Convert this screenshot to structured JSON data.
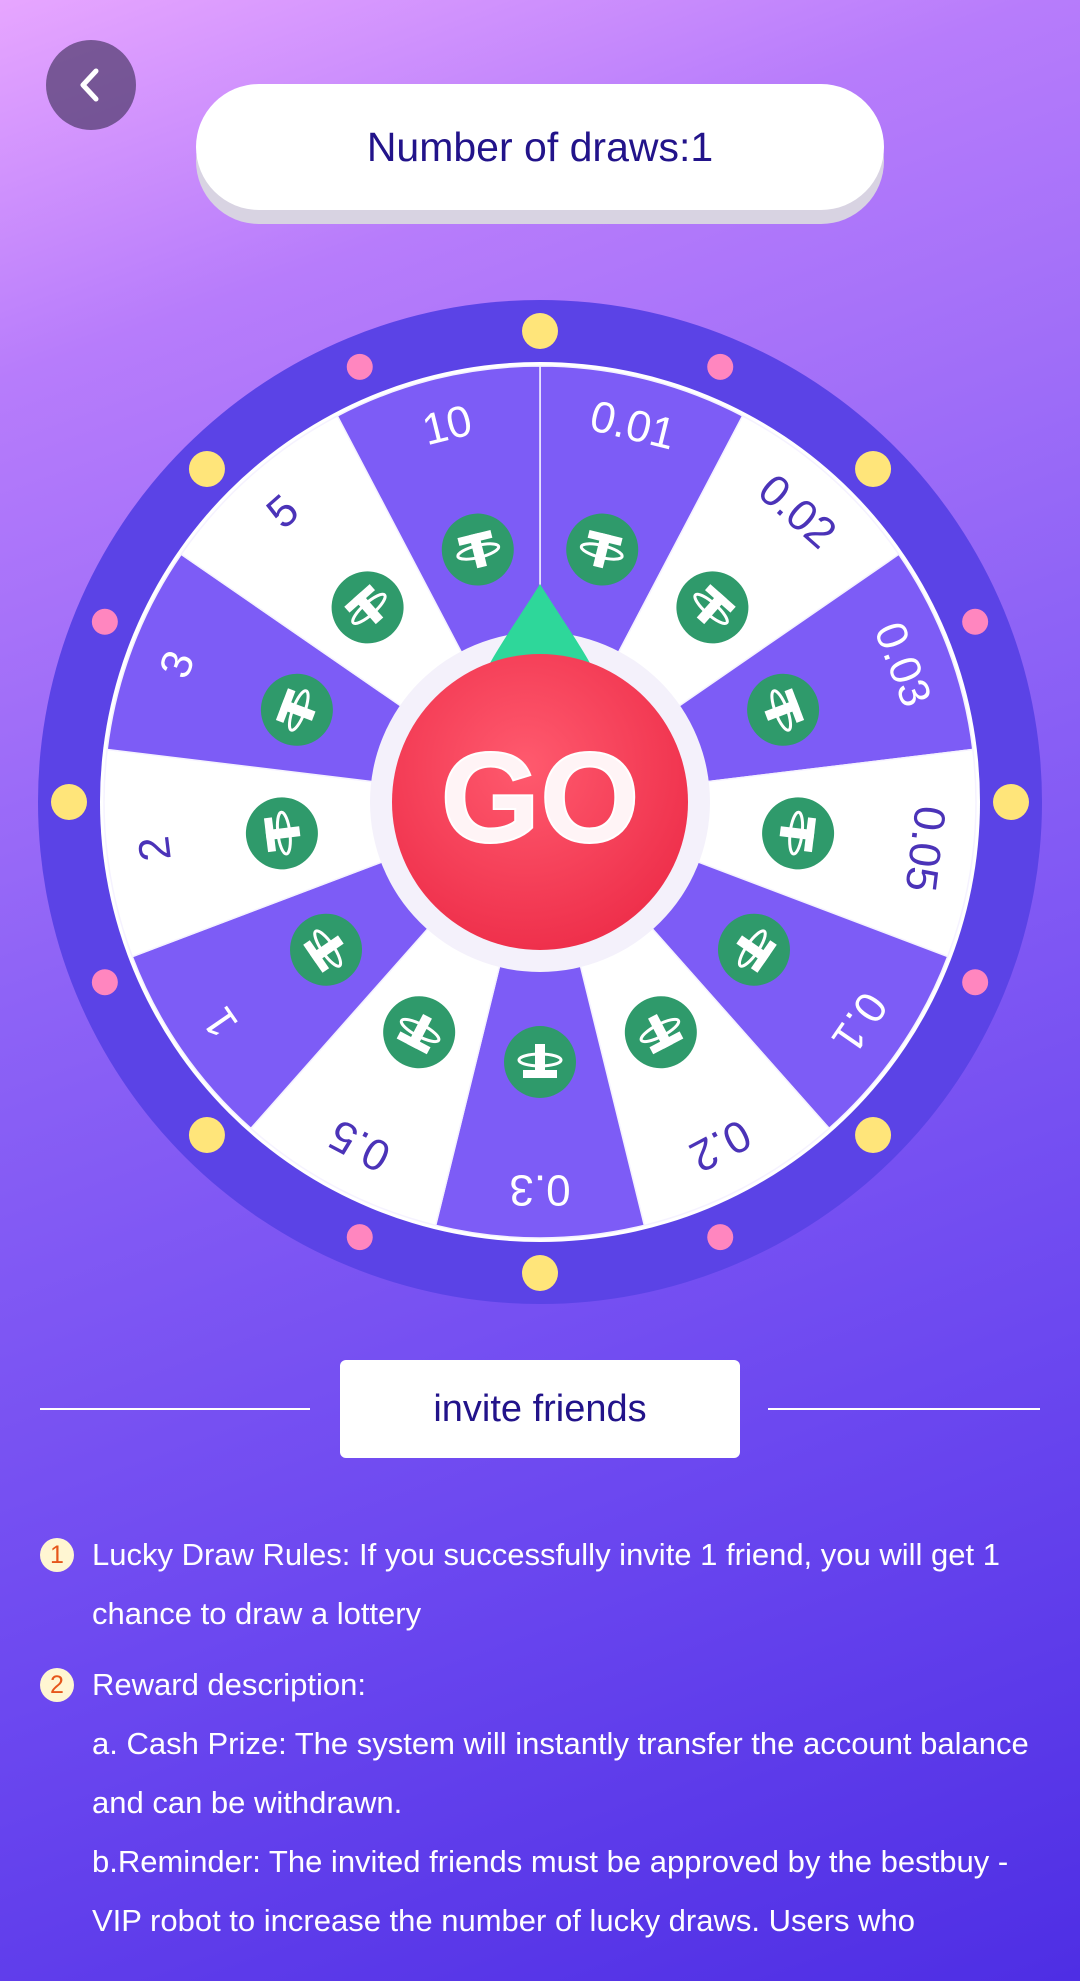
{
  "header": {
    "back_icon": "chevron-left-icon",
    "draws_label": "Number of draws:1"
  },
  "wheel": {
    "center_label": "GO",
    "coin_icon": "tether-coin-icon",
    "segments": [
      "0.01",
      "0.02",
      "0.03",
      "0.05",
      "0.1",
      "0.2",
      "0.3",
      "0.5",
      "1",
      "2",
      "3",
      "5",
      "10"
    ],
    "colors": {
      "rim": "#5b43e6",
      "purple_segment": "#7d5cf6",
      "white_segment": "#ffffff",
      "coin": "#2f9a6b",
      "go": "#ee2e4a",
      "pointer": "#2ed79a",
      "yellow_dot": "#ffe57a",
      "pink_dot": "#ff86bf"
    }
  },
  "invite": {
    "button_label": "invite friends"
  },
  "rules": [
    {
      "number": "1",
      "lines": [
        "Lucky Draw Rules: If you successfully invite 1 friend, you will get 1 chance to draw a lottery"
      ]
    },
    {
      "number": "2",
      "lines": [
        "Reward description:",
        "a. Cash Prize: The system will instantly transfer the account balance and can be withdrawn.",
        "b.Reminder: The invited friends must be approved by the bestbuy - VIP robot to increase the number of lucky draws. Users who"
      ]
    }
  ]
}
